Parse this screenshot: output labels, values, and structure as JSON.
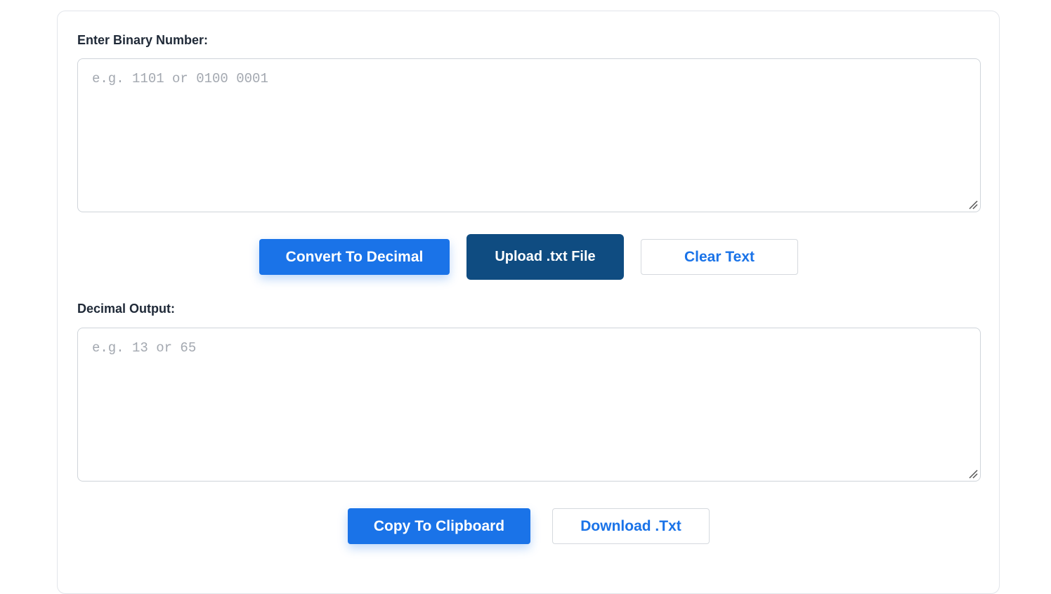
{
  "input_section": {
    "label": "Enter Binary Number:",
    "placeholder": "e.g. 1101 or 0100 0001",
    "value": ""
  },
  "actions": {
    "convert_label": "Convert To Decimal",
    "upload_label": "Upload .txt File",
    "clear_label": "Clear Text"
  },
  "output_section": {
    "label": "Decimal Output:",
    "placeholder": "e.g. 13 or 65",
    "value": ""
  },
  "output_actions": {
    "copy_label": "Copy To Clipboard",
    "download_label": "Download .Txt"
  },
  "icons": {
    "resize": "resize-handle-icon"
  },
  "colors": {
    "primary": "#1a73e8",
    "dark": "#0f4c81",
    "label_text": "#1f2937",
    "placeholder": "#a3a8b0",
    "border": "#cfd4da"
  }
}
